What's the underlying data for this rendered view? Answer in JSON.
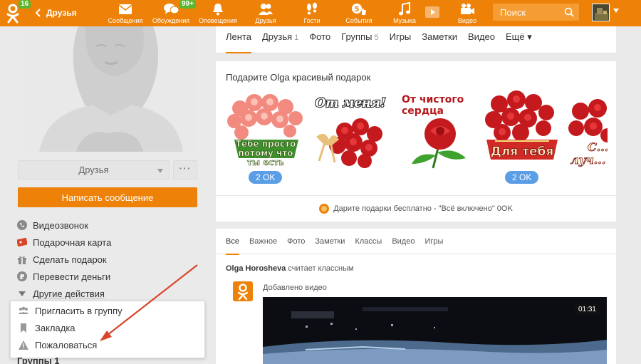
{
  "topbar": {
    "logo_badge": "16",
    "back_label": "Друзья",
    "nav": [
      {
        "label": "Сообщения",
        "icon": "envelope-icon",
        "count": ""
      },
      {
        "label": "Обсуждения",
        "icon": "chat-bubbles-icon",
        "count": "99+"
      },
      {
        "label": "Оповещения",
        "icon": "bell-icon",
        "count": ""
      },
      {
        "label": "Друзья",
        "icon": "people-icon",
        "count": ""
      },
      {
        "label": "Гости",
        "icon": "footprints-icon",
        "count": ""
      },
      {
        "label": "События",
        "icon": "events-icon",
        "count": ""
      },
      {
        "label": "Музыка",
        "icon": "music-note-icon",
        "count": ""
      },
      {
        "label": "Видео",
        "icon": "video-camera-icon",
        "count": ""
      }
    ],
    "search_placeholder": "Поиск"
  },
  "profile": {
    "friends_button": "Друзья",
    "more_button": "···",
    "write_button": "Написать сообщение",
    "actions": [
      {
        "label": "Видеозвонок",
        "icon": "phone-icon"
      },
      {
        "label": "Подарочная карта",
        "icon": "gift-card-icon"
      },
      {
        "label": "Сделать подарок",
        "icon": "gift-icon"
      },
      {
        "label": "Перевести деньги",
        "icon": "money-icon"
      },
      {
        "label": "Другие действия",
        "icon": "triangle-down-icon"
      }
    ],
    "dropdown": [
      {
        "label": "Пригласить в группу",
        "icon": "group-icon"
      },
      {
        "label": "Закладка",
        "icon": "bookmark-icon"
      },
      {
        "label": "Пожаловаться",
        "icon": "warning-icon"
      }
    ],
    "groups_peek": "Группы 1"
  },
  "tabs": [
    {
      "label": "Лента",
      "count": "",
      "active": true
    },
    {
      "label": "Друзья",
      "count": "1",
      "active": false
    },
    {
      "label": "Фото",
      "count": "",
      "active": false
    },
    {
      "label": "Группы",
      "count": "5",
      "active": false
    },
    {
      "label": "Игры",
      "count": "",
      "active": false
    },
    {
      "label": "Заметки",
      "count": "",
      "active": false
    },
    {
      "label": "Видео",
      "count": "",
      "active": false
    },
    {
      "label": "Ещё ▾",
      "count": "",
      "active": false
    }
  ],
  "gifts": {
    "title": "Подарите Olga красивый подарок",
    "items": [
      {
        "caption": "Тебе просто потому что ты есть",
        "price": "2 OK"
      },
      {
        "caption": "От меня!",
        "price": ""
      },
      {
        "caption": "От чистого сердца",
        "price": ""
      },
      {
        "caption": "Для тебя",
        "price": "2 OK"
      },
      {
        "caption": "С... луч...",
        "price": ""
      }
    ],
    "footer": "Дарите подарки бесплатно - \"Всё включено\" 0OK"
  },
  "feed": {
    "tabs": [
      "Все",
      "Важное",
      "Фото",
      "Заметки",
      "Классы",
      "Видео",
      "Игры"
    ],
    "author": "Olga Horosheva",
    "action": "считает классным",
    "added": "Добавлено видео",
    "duration": "01:31"
  },
  "colors": {
    "brand_orange": "#ee8208",
    "badge_green": "#5bb62e",
    "price_blue": "#5b9ee5",
    "arrow_red": "#d9452a"
  }
}
